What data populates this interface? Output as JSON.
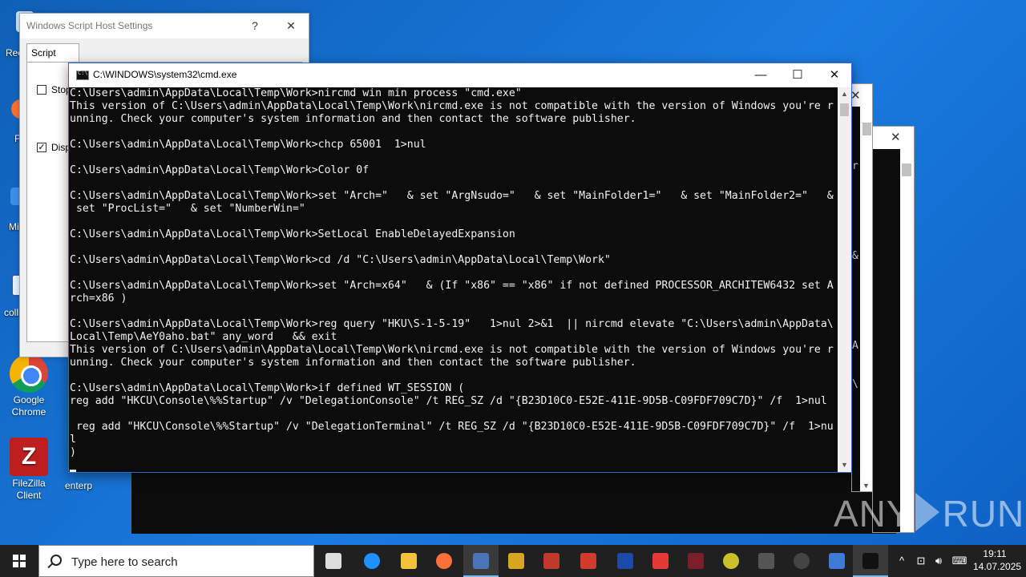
{
  "desktop": {
    "icons": {
      "recycle": "Rec",
      "chrome": "Google Chrome",
      "filezilla": "FileZilla Client",
      "f_label": "F",
      "mi_label": "Mi",
      "coll_label": "colli",
      "enterp_label": "enterp"
    }
  },
  "wsh": {
    "title": "Windows Script Host Settings",
    "help": "?",
    "close": "✕",
    "tab_script": "Script",
    "stop_label": "Stop",
    "display_label": "Disp",
    "display_checked": "✓"
  },
  "cmd": {
    "title": "C:\\WINDOWS\\system32\\cmd.exe",
    "minimize": "—",
    "maximize": "☐",
    "close": "✕",
    "lines": [
      "C:\\Users\\admin\\AppData\\Local\\Temp\\Work>nircmd win min process \"cmd.exe\"",
      "This version of C:\\Users\\admin\\AppData\\Local\\Temp\\Work\\nircmd.exe is not compatible with the version of Windows you're r",
      "unning. Check your computer's system information and then contact the software publisher.",
      "",
      "C:\\Users\\admin\\AppData\\Local\\Temp\\Work>chcp 65001  1>nul",
      "",
      "C:\\Users\\admin\\AppData\\Local\\Temp\\Work>Color 0f",
      "",
      "C:\\Users\\admin\\AppData\\Local\\Temp\\Work>set \"Arch=\"   & set \"ArgNsudo=\"   & set \"MainFolder1=\"   & set \"MainFolder2=\"   &",
      " set \"ProcList=\"   & set \"NumberWin=\"",
      "",
      "C:\\Users\\admin\\AppData\\Local\\Temp\\Work>SetLocal EnableDelayedExpansion",
      "",
      "C:\\Users\\admin\\AppData\\Local\\Temp\\Work>cd /d \"C:\\Users\\admin\\AppData\\Local\\Temp\\Work\"",
      "",
      "C:\\Users\\admin\\AppData\\Local\\Temp\\Work>set \"Arch=x64\"   & (If \"x86\" == \"x86\" if not defined PROCESSOR_ARCHITEW6432 set A",
      "rch=x86 )",
      "",
      "C:\\Users\\admin\\AppData\\Local\\Temp\\Work>reg query \"HKU\\S-1-5-19\"   1>nul 2>&1  || nircmd elevate \"C:\\Users\\admin\\AppData\\",
      "Local\\Temp\\AeY0aho.bat\" any_word   && exit",
      "This version of C:\\Users\\admin\\AppData\\Local\\Temp\\Work\\nircmd.exe is not compatible with the version of Windows you're r",
      "unning. Check your computer's system information and then contact the software publisher.",
      "",
      "C:\\Users\\admin\\AppData\\Local\\Temp\\Work>if defined WT_SESSION (",
      "reg add \"HKCU\\Console\\%%Startup\" /v \"DelegationConsole\" /t REG_SZ /d \"{B23D10C0-E52E-411E-9D5B-C09FDF709C7D}\" /f  1>nul",
      "",
      " reg add \"HKCU\\Console\\%%Startup\" /v \"DelegationTerminal\" /t REG_SZ /d \"{B23D10C0-E52E-411E-9D5B-C09FDF709C7D}\" /f  1>nu",
      "l",
      ")"
    ]
  },
  "bgwindows": {
    "close1": "✕",
    "close2": "✕",
    "frag_r": "r",
    "frag_amp": "&",
    "frag_A": "A",
    "frag_bs": "\\"
  },
  "taskbar": {
    "search_placeholder": "Type here to search",
    "icons": [
      "task-view-icon",
      "edge-icon",
      "file-explorer-icon",
      "firefox-icon",
      "registry-tool-icon",
      "keys-tool-icon",
      "calculator-tool-icon",
      "acrobat-icon",
      "r-app-icon",
      "shapes-app-icon",
      "bird-app-icon",
      "kiwi-app-icon",
      "cmd-taskbar-icon",
      "ninja-app-icon",
      "notepad-icon",
      "terminal-icon"
    ],
    "tray_chevron": "^",
    "time": "19:11",
    "date": "14.07.2025"
  },
  "watermark": {
    "left": "ANY",
    "right": "RUN"
  }
}
